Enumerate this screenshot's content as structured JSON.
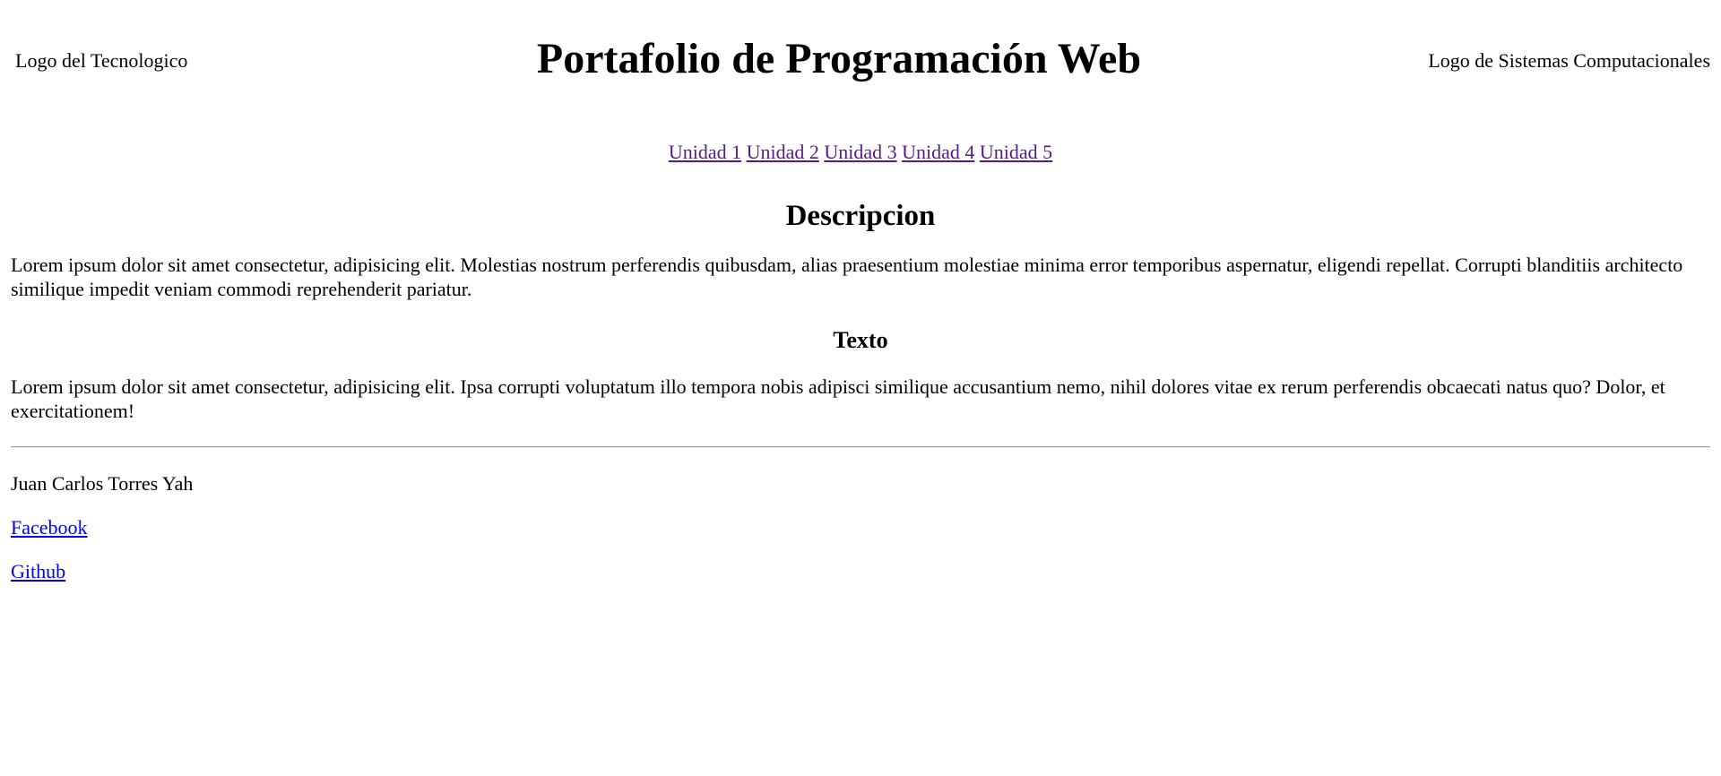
{
  "header": {
    "left_image_alt": "Logo del Tecnologico",
    "title": "Portafolio de Programación Web",
    "right_image_alt": "Logo de Sistemas Computacionales"
  },
  "nav": {
    "links": [
      "Unidad 1",
      "Unidad 2",
      "Unidad 3",
      "Unidad 4",
      "Unidad 5"
    ]
  },
  "main": {
    "heading": "Descripcion",
    "description_text": "Lorem ipsum dolor sit amet consectetur, adipisicing elit. Molestias nostrum perferendis quibusdam, alias praesentium molestiae minima error temporibus aspernatur, eligendi repellat. Corrupti blanditiis architecto similique impedit veniam commodi reprehenderit pariatur.",
    "subheading": "Texto",
    "texto_text": "Lorem ipsum dolor sit amet consectetur, adipisicing elit. Ipsa corrupti voluptatum illo tempora nobis adipisci similique accusantium nemo, nihil dolores vitae ex rerum perferendis obcaecati natus quo? Dolor, et exercitationem!"
  },
  "footer": {
    "author": "Juan Carlos Torres Yah",
    "facebook_label": "Facebook",
    "github_label": "Github"
  },
  "colors": {
    "visited_link": "#551a8b",
    "link": "#0000ee",
    "text": "#000000",
    "background": "#ffffff"
  }
}
